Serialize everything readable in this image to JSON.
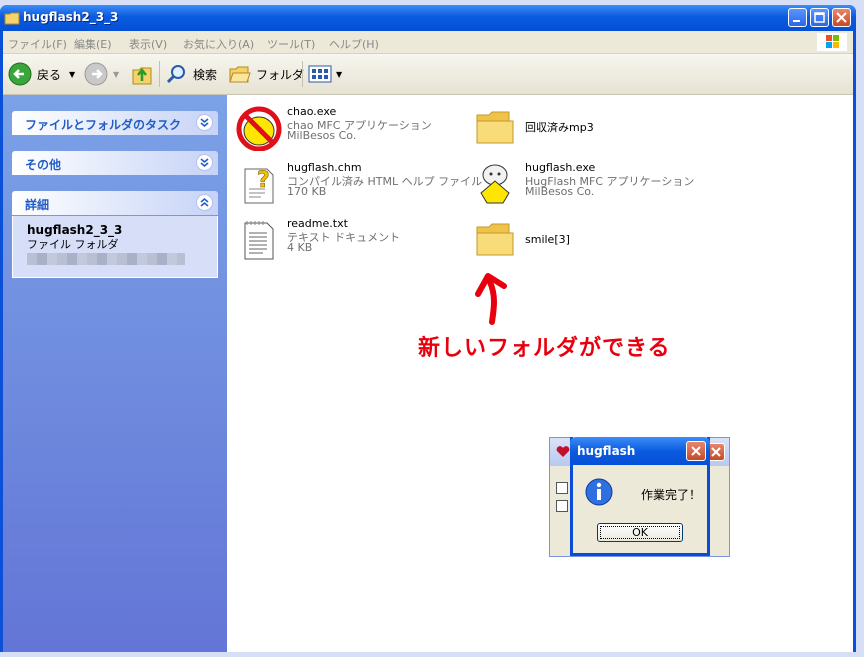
{
  "window": {
    "title": "hugflash2_3_3"
  },
  "menubar": {
    "items": [
      "ファイル(F)",
      "編集(E)",
      "表示(V)",
      "お気に入り(A)",
      "ツール(T)",
      "ヘルプ(H)"
    ]
  },
  "toolbar": {
    "back_label": "戻る",
    "search_label": "検索",
    "folders_label": "フォルダ"
  },
  "leftpane": {
    "tasks_title": "ファイルとフォルダのタスク",
    "other_title": "その他",
    "details_title": "詳細",
    "details_name": "hugflash2_3_3",
    "details_type": "ファイル フォルダ"
  },
  "files": [
    {
      "name": "chao.exe",
      "line1": "chao MFC アプリケーション",
      "line2": "MilBesos Co.",
      "icon": "no-entry-app-icon"
    },
    {
      "name": "回収済みmp3",
      "line1": "",
      "line2": "",
      "icon": "folder-icon"
    },
    {
      "name": "hugflash.chm",
      "line1": "コンパイル済み HTML ヘルプ ファイル",
      "line2": "170 KB",
      "icon": "help-file-icon"
    },
    {
      "name": "hugflash.exe",
      "line1": "HugFlash MFC アプリケーション",
      "line2": "MilBesos Co.",
      "icon": "hugflash-app-icon"
    },
    {
      "name": "readme.txt",
      "line1": "テキスト ドキュメント",
      "line2": "4 KB",
      "icon": "text-document-icon"
    },
    {
      "name": "smile[3]",
      "line1": "",
      "line2": "",
      "icon": "folder-icon"
    }
  ],
  "annotation": {
    "text": "新しいフォルダができる",
    "color": "#e8000e"
  },
  "dialog": {
    "title": "hugflash",
    "message": "作業完了！",
    "ok_label": "OK"
  },
  "colors": {
    "titlebar": "#0b5be0",
    "leftpane": "#7ba2e7",
    "accent_text": "#215dc6"
  }
}
